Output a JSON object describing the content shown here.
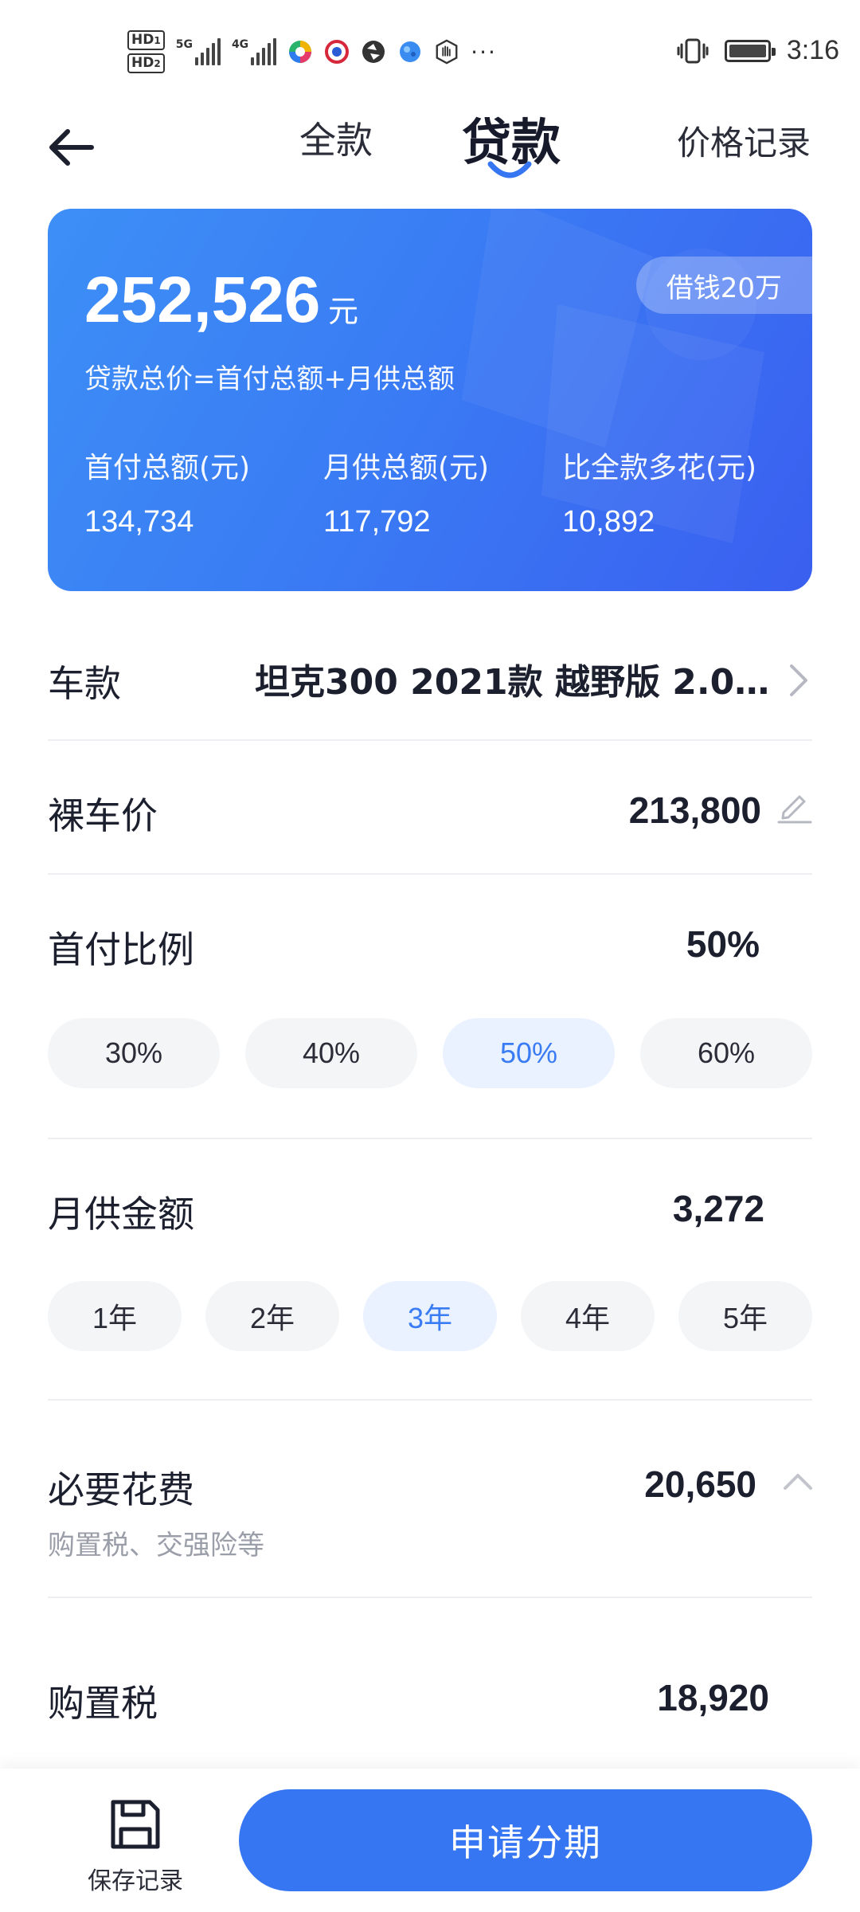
{
  "status_bar": {
    "hd1": "HD",
    "hd1_sub": "1",
    "hd2": "HD",
    "hd2_sub": "2",
    "net1": "5G",
    "net2": "4G",
    "more": "···",
    "time": "3:16",
    "icons": [
      "vibrate-icon",
      "battery-icon"
    ]
  },
  "header": {
    "tab_full": "全款",
    "tab_loan": "贷款",
    "active_tab": "贷款",
    "price_record": "价格记录"
  },
  "summary": {
    "total": "252,526",
    "unit": "元",
    "loan_tag": "借钱20万",
    "formula": "贷款总价=首付总额+月供总额",
    "metrics": [
      {
        "label": "首付总额(元)",
        "value": "134,734"
      },
      {
        "label": "月供总额(元)",
        "value": "117,792"
      },
      {
        "label": "比全款多花(元)",
        "value": "10,892"
      }
    ]
  },
  "model": {
    "label": "车款",
    "value": "坦克300 2021款 越野版 2.0T..."
  },
  "bare_price": {
    "label": "裸车价",
    "value": "213,800"
  },
  "down_payment": {
    "label": "首付比例",
    "value": "50%",
    "options": [
      "30%",
      "40%",
      "50%",
      "60%"
    ],
    "selected": "50%"
  },
  "monthly": {
    "label": "月供金额",
    "value": "3,272",
    "options": [
      "1年",
      "2年",
      "3年",
      "4年",
      "5年"
    ],
    "selected": "3年"
  },
  "required_fees": {
    "label": "必要花费",
    "value": "20,650",
    "note": "购置税、交强险等"
  },
  "purchase_tax": {
    "label": "购置税",
    "value": "18,920"
  },
  "bottom": {
    "save_label": "保存记录",
    "apply_label": "申请分期"
  },
  "colors": {
    "accent": "#3676f2",
    "card_start": "#3d8ff6",
    "card_end": "#3a5ff0",
    "chip_active_bg": "#eaf2ff",
    "chip_bg": "#f4f5f7"
  }
}
